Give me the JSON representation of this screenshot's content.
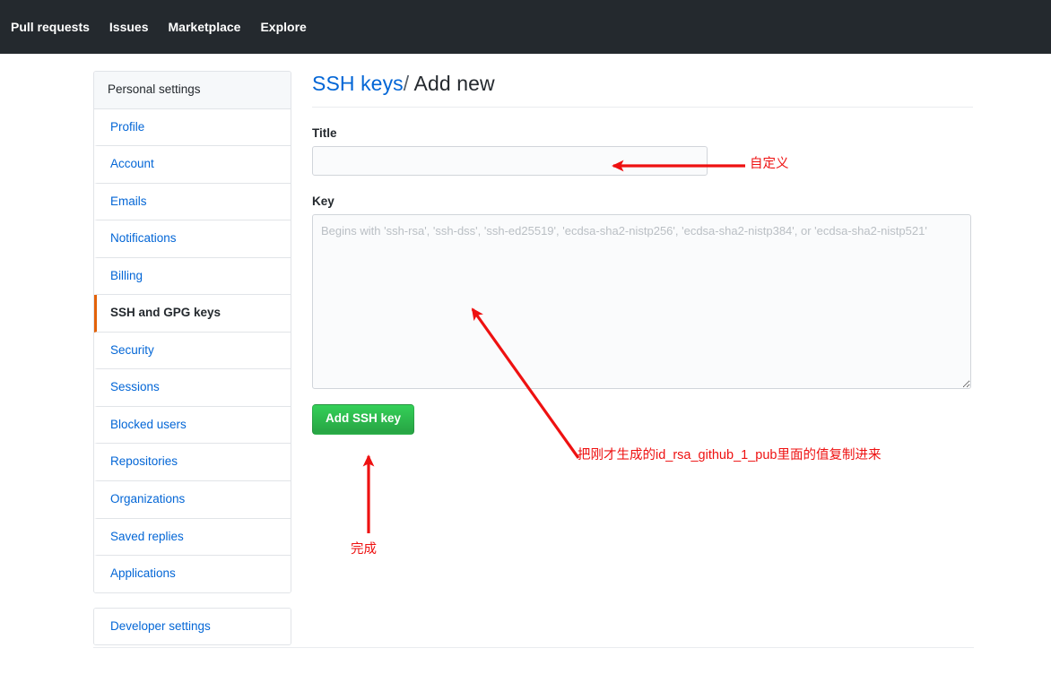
{
  "topnav": {
    "links": [
      {
        "label": "Pull requests"
      },
      {
        "label": "Issues"
      },
      {
        "label": "Marketplace"
      },
      {
        "label": "Explore"
      }
    ],
    "background_color": "#24292e"
  },
  "sidebar": {
    "header": "Personal settings",
    "items": [
      {
        "label": "Profile",
        "selected": false
      },
      {
        "label": "Account",
        "selected": false
      },
      {
        "label": "Emails",
        "selected": false
      },
      {
        "label": "Notifications",
        "selected": false
      },
      {
        "label": "Billing",
        "selected": false
      },
      {
        "label": "SSH and GPG keys",
        "selected": true
      },
      {
        "label": "Security",
        "selected": false
      },
      {
        "label": "Sessions",
        "selected": false
      },
      {
        "label": "Blocked users",
        "selected": false
      },
      {
        "label": "Repositories",
        "selected": false
      },
      {
        "label": "Organizations",
        "selected": false
      },
      {
        "label": "Saved replies",
        "selected": false
      },
      {
        "label": "Applications",
        "selected": false
      }
    ],
    "developer_settings": "Developer settings",
    "active_accent_color": "#e36209",
    "link_color": "#0366d6"
  },
  "main": {
    "heading_link": "SSH keys",
    "heading_separator": "/",
    "heading_current": "Add new",
    "title_field": {
      "label": "Title",
      "value": "",
      "placeholder": ""
    },
    "key_field": {
      "label": "Key",
      "value": "",
      "placeholder": "Begins with 'ssh-rsa', 'ssh-dss', 'ssh-ed25519', 'ecdsa-sha2-nistp256', 'ecdsa-sha2-nistp384', or 'ecdsa-sha2-nistp521'"
    },
    "submit_button": {
      "label": "Add SSH key",
      "color": "#28a745"
    }
  },
  "annotations": {
    "color": "#ee1111",
    "title_note": "自定义",
    "key_note": "把刚才生成的id_rsa_github_1_pub里面的值复制进来",
    "button_note": "完成"
  }
}
